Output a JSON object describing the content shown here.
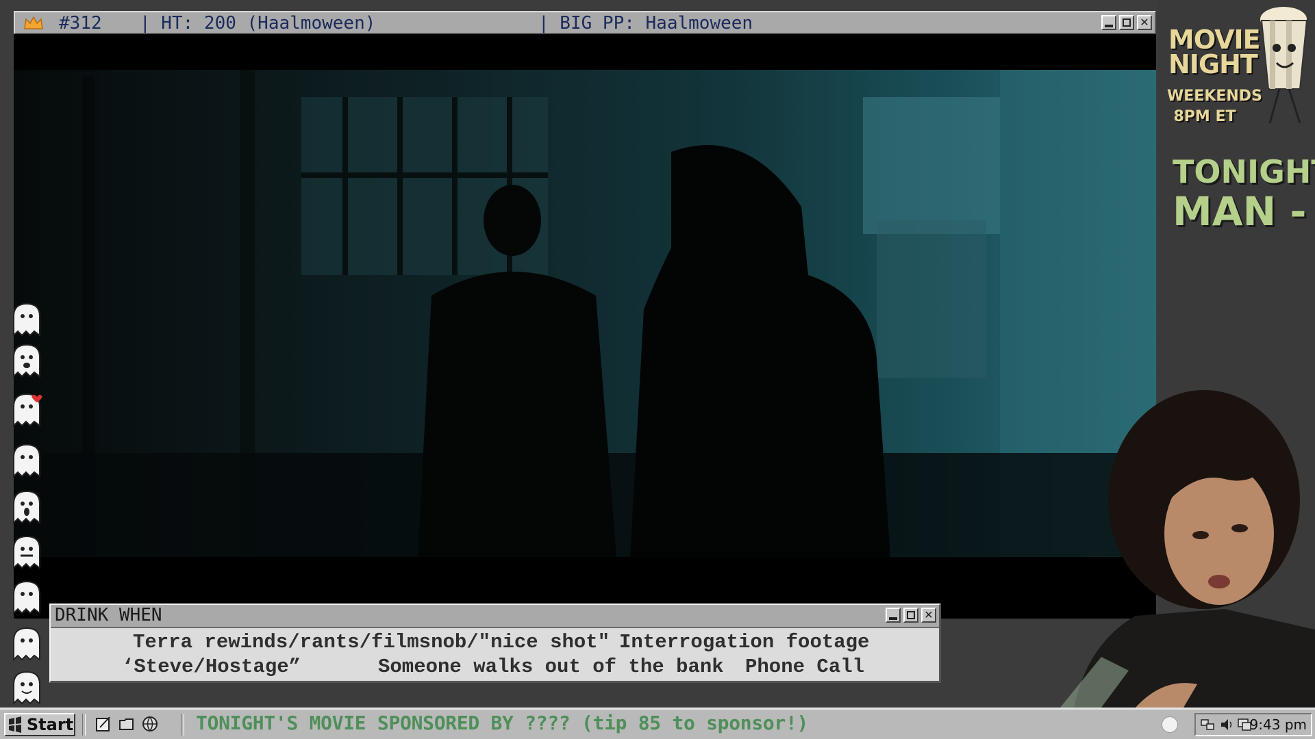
{
  "window": {
    "counter": "#312",
    "ht": "| HT: 200 (Haalmoween)",
    "big_pp": "| BIG PP: Haalmoween"
  },
  "sidebar": {
    "movie_night": "MOVIE NIGHT",
    "weekends": "WEEKENDS",
    "time": "8PM ET",
    "tonight_label": "TONIGHT:",
    "tonight_title": "MAN - I"
  },
  "drink_when": {
    "title": "DRINK WHEN",
    "items": [
      "Terra rewinds/rants/filmsnob/\"nice shot\"",
      "Interrogation footage",
      "‘Steve/Hostage”",
      "Someone walks out of the bank",
      "Phone Call"
    ]
  },
  "taskbar": {
    "start_label": "Start",
    "marquee": "TONIGHT'S MOVIE SPONSORED BY ???? (tip 85 to sponsor!)",
    "clock": "9:43 pm"
  },
  "colors": {
    "title_text": "#1b2a5c",
    "marquee_green": "#4f8f5a",
    "poster_yellow": "#e8d79a",
    "tonight_green": "#b4d08a"
  }
}
